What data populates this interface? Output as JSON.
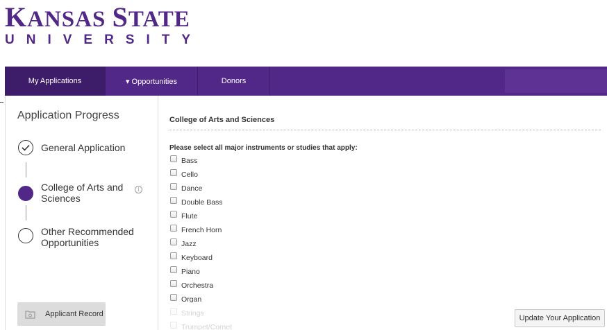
{
  "logo": {
    "line1_k": "K",
    "line1_ansas": "ANSAS",
    "line1_s": "S",
    "line1_tate": "TATE",
    "line2": "UNIVERSITY"
  },
  "nav": {
    "items": [
      {
        "label": "My Applications"
      },
      {
        "label": "▾ Opportunities"
      },
      {
        "label": "Donors"
      }
    ]
  },
  "sidebar": {
    "title": "Application Progress",
    "steps": [
      {
        "label": "General Application",
        "status": "complete"
      },
      {
        "label": "College of Arts and Sciences",
        "status": "current"
      },
      {
        "label": "Other Recommended Opportunities",
        "status": "pending"
      }
    ],
    "info_icon": "i",
    "record_button": "Applicant Record"
  },
  "main": {
    "section_title": "College of Arts and Sciences",
    "prompt": "Please select all major instruments or studies that apply:",
    "options": [
      "Bass",
      "Cello",
      "Dance",
      "Double Bass",
      "Flute",
      "French Horn",
      "Jazz",
      "Keyboard",
      "Piano",
      "Orchestra",
      "Organ",
      "Strings",
      "Trumpet/Cornet"
    ]
  },
  "footer": {
    "update_button": "Update Your Application"
  },
  "colors": {
    "brand_purple": "#512888",
    "nav_active": "#3d1c69"
  }
}
